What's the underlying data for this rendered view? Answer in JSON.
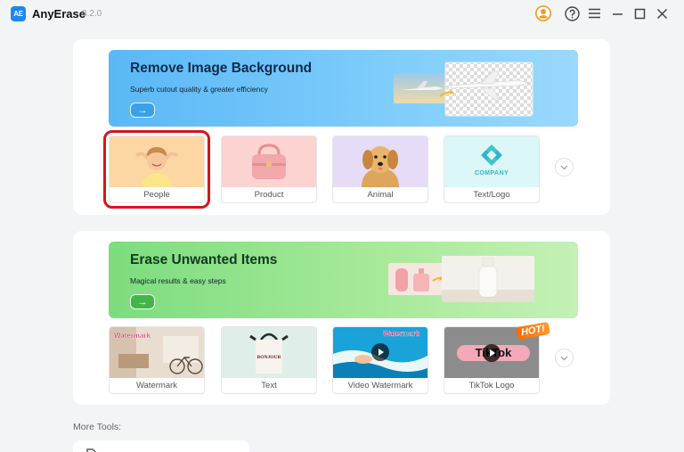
{
  "app": {
    "logo_text": "AE",
    "title": "AnyErase",
    "version": "3.2.0"
  },
  "titlebar": {
    "icons": [
      "avatar-icon",
      "help-icon",
      "menu-icon",
      "minimize-icon",
      "maximize-icon",
      "close-icon"
    ]
  },
  "remove_bg": {
    "title": "Remove Image Background",
    "subtitle": "Superb cutout quality & greater efficiency",
    "button_glyph": "→",
    "tiles": [
      {
        "label": "People",
        "selected": true
      },
      {
        "label": "Product",
        "selected": false
      },
      {
        "label": "Animal",
        "selected": false
      },
      {
        "label": "Text/Logo",
        "selected": false
      }
    ],
    "company_text": "COMPANY"
  },
  "erase": {
    "title": "Erase Unwanted Items",
    "subtitle": "Magical results & easy steps",
    "button_glyph": "→",
    "tiles": [
      {
        "label": "Watermark"
      },
      {
        "label": "Text"
      },
      {
        "label": "Video Watermark"
      },
      {
        "label": "TikTok Logo"
      }
    ],
    "watermark_overlay": "Watermark",
    "video_watermark_overlay": "Watermark",
    "bag_text": "BONJOUR",
    "tiktok_text": "TikTok",
    "hot_badge": "HOT!"
  },
  "more_tools": {
    "label": "More Tools:"
  },
  "colors": {
    "accent": "#1e88f0",
    "selection": "#d4161b",
    "blue_banner": "#7fcdfb",
    "green_banner": "#a9ea9b"
  }
}
